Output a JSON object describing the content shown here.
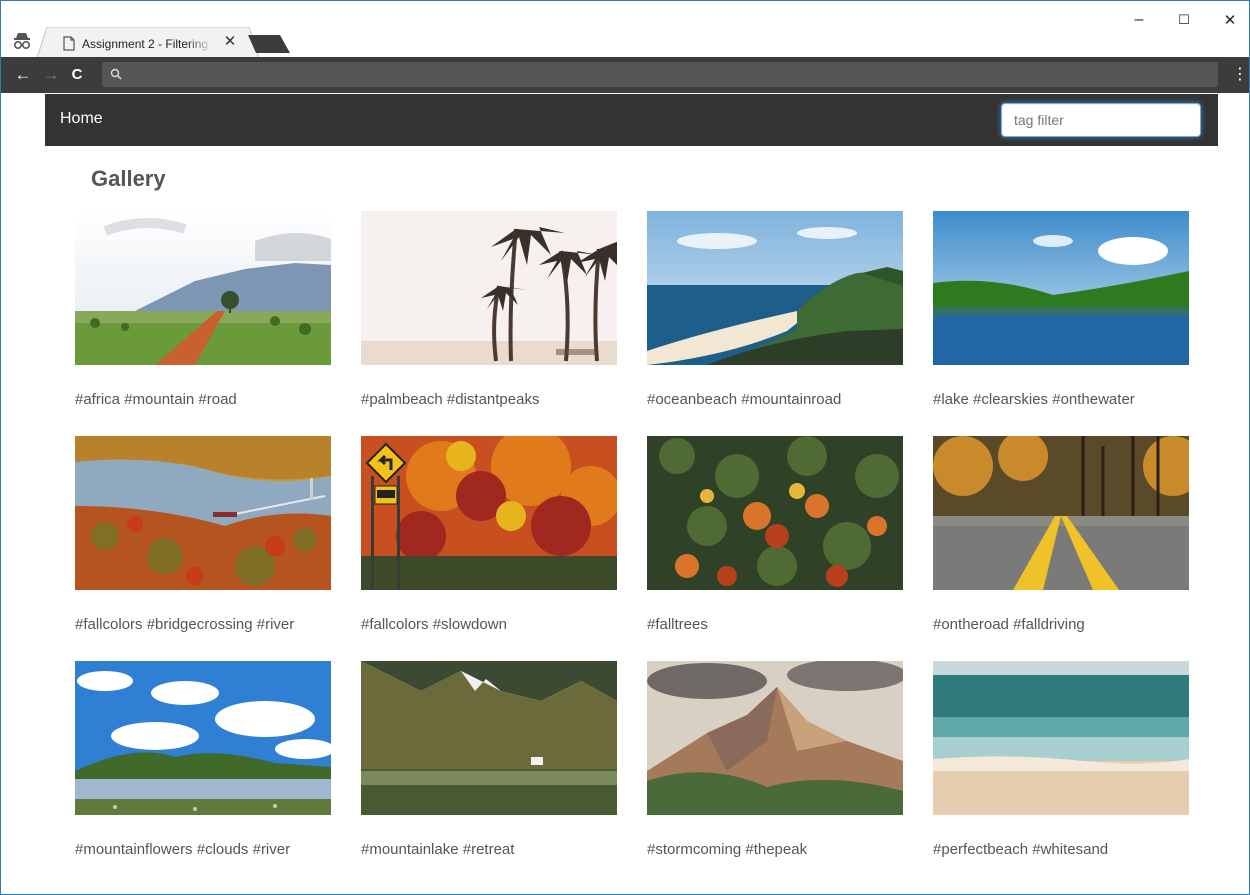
{
  "browser": {
    "tab_title": "Assignment 2 - Filtering",
    "close_glyph": "✕",
    "minimize_glyph": "–",
    "maximize_glyph": "☐",
    "window_close_glyph": "✕",
    "back_glyph": "←",
    "forward_glyph": "→",
    "reload_glyph": "C",
    "menu_glyph": "⋮",
    "address_value": ""
  },
  "nav": {
    "home_label": "Home",
    "filter_placeholder": "tag filter"
  },
  "gallery": {
    "title": "Gallery",
    "items": [
      {
        "tags": "#africa #mountain #road",
        "scene": "savanna-road"
      },
      {
        "tags": "#palmbeach #distantpeaks",
        "scene": "palm-beach"
      },
      {
        "tags": "#oceanbeach #mountainroad",
        "scene": "ocean-coast"
      },
      {
        "tags": "#lake #clearskies #onthewater",
        "scene": "lake"
      },
      {
        "tags": "#fallcolors #bridgecrossing #river",
        "scene": "fall-river-bridge"
      },
      {
        "tags": "#fallcolors #slowdown",
        "scene": "fall-sign"
      },
      {
        "tags": "#falltrees",
        "scene": "fall-canopy"
      },
      {
        "tags": "#ontheroad #falldriving",
        "scene": "fall-road"
      },
      {
        "tags": "#mountainflowers #clouds #river",
        "scene": "cloud-hills"
      },
      {
        "tags": "#mountainlake #retreat",
        "scene": "highland-lake"
      },
      {
        "tags": "#stormcoming #thepeak",
        "scene": "rocky-peak"
      },
      {
        "tags": "#perfectbeach #whitesand",
        "scene": "sandy-shore"
      }
    ]
  }
}
